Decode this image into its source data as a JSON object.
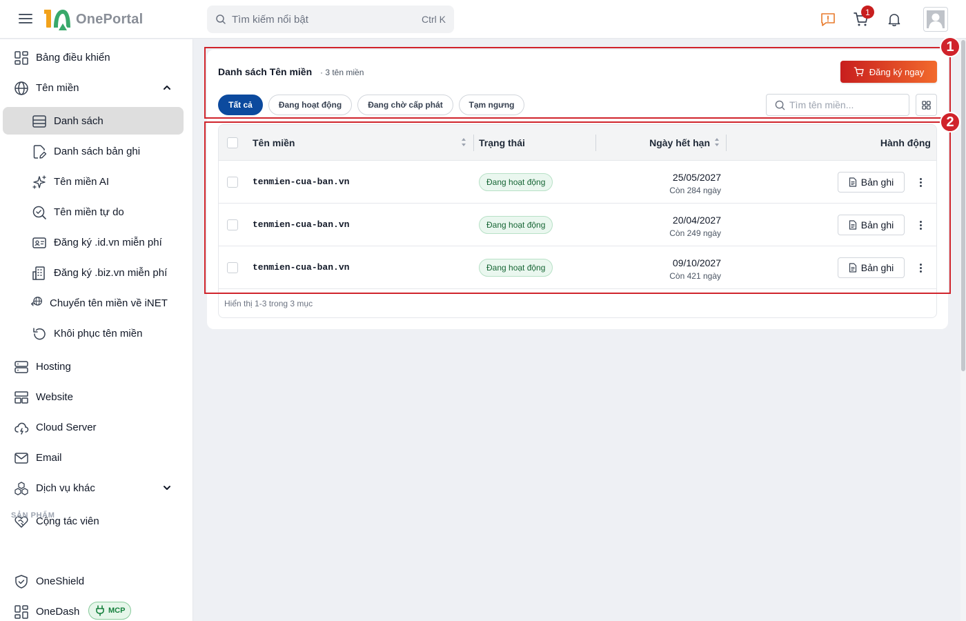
{
  "app": {
    "name": "OnePortal"
  },
  "search": {
    "placeholder": "Tìm kiếm nổi bật",
    "shortcut": "Ctrl K"
  },
  "header": {
    "cart_count": "1"
  },
  "sidebar": {
    "items": [
      {
        "label": "Bảng điều khiển",
        "icon": "dashboard-grid-icon"
      },
      {
        "label": "Tên miền",
        "icon": "globe-icon",
        "expanded": true
      },
      {
        "label": "Danh sách",
        "icon": "list-table-icon",
        "active": true
      },
      {
        "label": "Danh sách bản ghi",
        "icon": "file-edit-icon"
      },
      {
        "label": "Tên miền AI",
        "icon": "sparkles-icon"
      },
      {
        "label": "Tên miền tự do",
        "icon": "search-check-icon"
      },
      {
        "label": "Đăng ký .id.vn miễn phí",
        "icon": "id-card-icon"
      },
      {
        "label": "Đăng ký .biz.vn miễn phí",
        "icon": "building-icon"
      },
      {
        "label": "Chuyển tên miền về iNET",
        "icon": "transfer-globe-icon"
      },
      {
        "label": "Khôi phục tên miền",
        "icon": "restore-icon"
      },
      {
        "label": "Hosting",
        "icon": "server-icon"
      },
      {
        "label": "Website",
        "icon": "website-layout-icon"
      },
      {
        "label": "Cloud Server",
        "icon": "cloud-icon"
      },
      {
        "label": "Email",
        "icon": "mail-icon"
      },
      {
        "label": "Dịch vụ khác",
        "icon": "boxes-icon"
      },
      {
        "label": "Cộng tác viên",
        "icon": "handshake-heart-icon"
      },
      {
        "label": "OneShield",
        "icon": "shield-check-icon"
      },
      {
        "label": "OneDash",
        "icon": "dashboard-grid-icon"
      }
    ],
    "section_products": "SẢN PHẨM",
    "mcp_badge": "MCP"
  },
  "page": {
    "title": "Danh sách Tên miền",
    "count": "· 3 tên miền",
    "register_button": "Đăng ký ngay",
    "filters": [
      "Tất cả",
      "Đang hoạt động",
      "Đang chờ cấp phát",
      "Tạm ngưng"
    ],
    "active_filter": "Tất cả",
    "filter_search_placeholder": "Tìm tên miền..."
  },
  "table": {
    "columns": [
      "Tên miền",
      "Trạng thái",
      "Ngày hết hạn",
      "Hành động"
    ],
    "rows": [
      {
        "domain": "tenmien-cua-ban.vn",
        "status": "Đang hoạt động",
        "expiry": "25/05/2027",
        "remaining": "Còn 284 ngày",
        "action": "Bản ghi"
      },
      {
        "domain": "tenmien-cua-ban.vn",
        "status": "Đang hoạt động",
        "expiry": "20/04/2027",
        "remaining": "Còn 249 ngày",
        "action": "Bản ghi"
      },
      {
        "domain": "tenmien-cua-ban.vn",
        "status": "Đang hoạt động",
        "expiry": "09/10/2027",
        "remaining": "Còn 421 ngày",
        "action": "Bản ghi"
      }
    ],
    "pagination_info": "Hiển thị 1-3 trong 3 mục"
  },
  "annotations": {
    "box1": "1",
    "box2": "2"
  },
  "colors": {
    "accent": "#0c4a9e",
    "brand_red": "#c81e1e",
    "annotation": "#d0232b",
    "status_green": "#166534"
  }
}
